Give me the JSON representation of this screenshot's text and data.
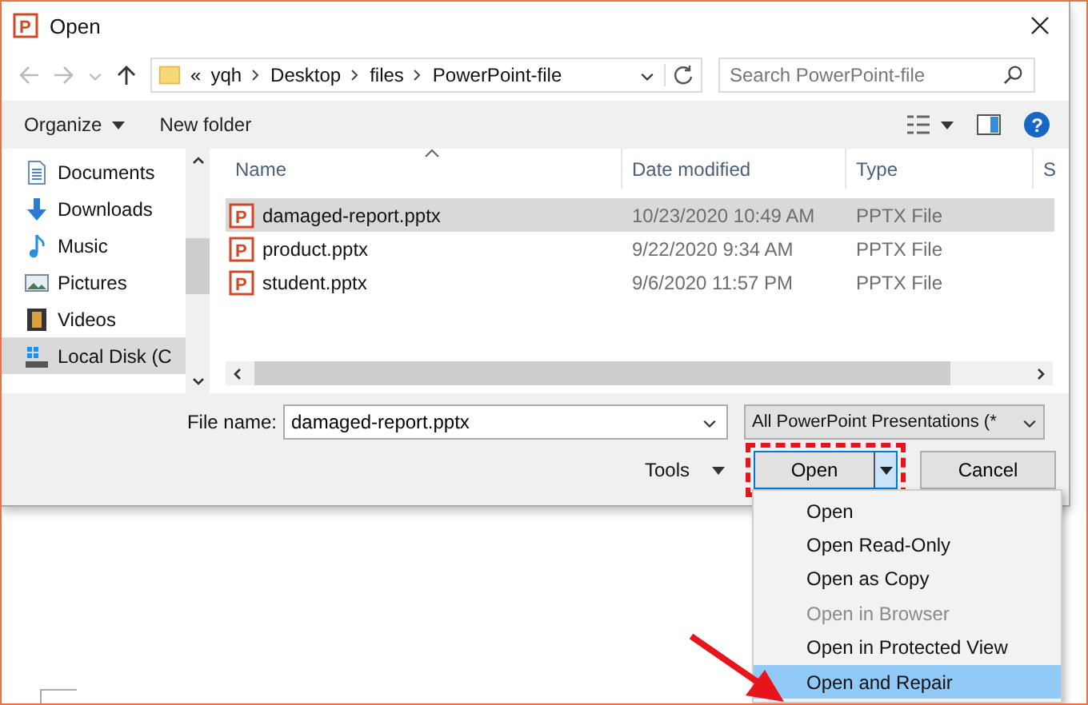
{
  "window": {
    "title": "Open",
    "icon_text": "P"
  },
  "nav": {
    "breadcrumb": [
      "«",
      "yqh",
      "Desktop",
      "files",
      "PowerPoint-file"
    ],
    "search": {
      "placeholder": "Search PowerPoint-file"
    }
  },
  "toolbar": {
    "organize": "Organize",
    "new_folder": "New folder",
    "help": "?"
  },
  "sidebar": {
    "items": [
      {
        "label": "Documents",
        "kind": "documents",
        "selected": false
      },
      {
        "label": "Downloads",
        "kind": "downloads",
        "selected": false
      },
      {
        "label": "Music",
        "kind": "music",
        "selected": false
      },
      {
        "label": "Pictures",
        "kind": "pictures",
        "selected": false
      },
      {
        "label": "Videos",
        "kind": "videos",
        "selected": false
      },
      {
        "label": "Local Disk (C",
        "kind": "drive",
        "selected": true
      }
    ]
  },
  "table": {
    "columns": [
      "Name",
      "Date modified",
      "Type",
      "S"
    ],
    "rows": [
      {
        "icon_text": "P",
        "name": "damaged-report.pptx",
        "date": "10/23/2020 10:49 AM",
        "type": "PPTX File",
        "selected": true
      },
      {
        "icon_text": "P",
        "name": "product.pptx",
        "date": "9/22/2020 9:34 AM",
        "type": "PPTX File",
        "selected": false
      },
      {
        "icon_text": "P",
        "name": "student.pptx",
        "date": "9/6/2020 11:57 PM",
        "type": "PPTX File",
        "selected": false
      }
    ]
  },
  "footer": {
    "file_name_label": "File name:",
    "file_name": "damaged-report.pptx",
    "filter": "All PowerPoint Presentations (*",
    "tools": "Tools",
    "open": "Open",
    "cancel": "Cancel"
  },
  "menu": {
    "items": [
      {
        "label": "Open",
        "disabled": false,
        "selected": false
      },
      {
        "label": "Open Read-Only",
        "disabled": false,
        "selected": false
      },
      {
        "label": "Open as Copy",
        "disabled": false,
        "selected": false
      },
      {
        "label": "Open in Browser",
        "disabled": true,
        "selected": false
      },
      {
        "label": "Open in Protected View",
        "disabled": false,
        "selected": false
      },
      {
        "label": "Open and Repair",
        "disabled": false,
        "selected": true
      }
    ]
  }
}
